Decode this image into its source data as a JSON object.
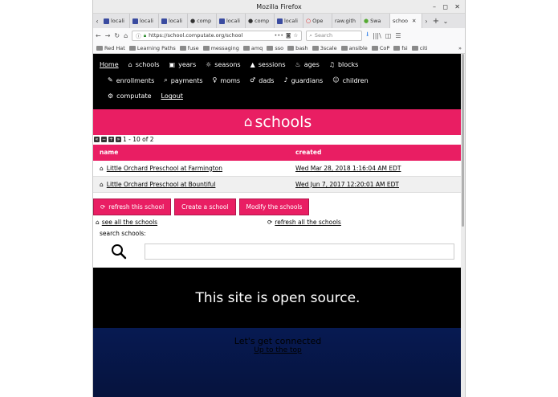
{
  "window": {
    "title": "Mozilla Firefox",
    "controls": [
      "–",
      "◻",
      "✕"
    ]
  },
  "tabs": [
    {
      "label": "locali",
      "icon": "site-icon"
    },
    {
      "label": "locali",
      "icon": "site-icon"
    },
    {
      "label": "locali",
      "icon": "site-icon"
    },
    {
      "label": "comp",
      "icon": "github-icon"
    },
    {
      "label": "locali",
      "icon": "site-icon"
    },
    {
      "label": "comp",
      "icon": "github-icon"
    },
    {
      "label": "locali",
      "icon": "site-icon"
    },
    {
      "label": "Ope",
      "icon": "openshift-icon"
    },
    {
      "label": "raw.gith",
      "icon": ""
    },
    {
      "label": "Swa",
      "icon": "swagger-icon"
    },
    {
      "label": "schoo",
      "icon": "",
      "active": true
    }
  ],
  "navbar": {
    "url": "https://school.computate.org/school",
    "search_placeholder": "Search"
  },
  "bookmarks": [
    "Red Hat",
    "Learning Paths",
    "fuse",
    "messaging",
    "amq",
    "sso",
    "bash",
    "3scale",
    "ansible",
    "CoP",
    "fsi",
    "citi"
  ],
  "topnav": {
    "row1": [
      {
        "label": "Home",
        "icon": "",
        "underline": true
      },
      {
        "label": "schools",
        "icon": "school-icon"
      },
      {
        "label": "years",
        "icon": "calendar-check-icon"
      },
      {
        "label": "seasons",
        "icon": "sun-icon"
      },
      {
        "label": "sessions",
        "icon": "graduation-cap-icon"
      },
      {
        "label": "ages",
        "icon": "birthday-cake-icon"
      },
      {
        "label": "blocks",
        "icon": "bell-icon"
      }
    ],
    "row2": [
      {
        "label": "enrollments",
        "icon": "edit-icon"
      },
      {
        "label": "payments",
        "icon": "search-dollar-icon"
      },
      {
        "label": "moms",
        "icon": "female-icon"
      },
      {
        "label": "dads",
        "icon": "male-icon"
      },
      {
        "label": "guardians",
        "icon": "guitar-icon"
      },
      {
        "label": "children",
        "icon": "child-icon"
      }
    ],
    "row3": [
      {
        "label": "computate",
        "icon": "user-cog-icon"
      },
      {
        "label": "Logout",
        "icon": "",
        "underline": true
      }
    ]
  },
  "banner": {
    "title": "schools"
  },
  "pager": {
    "text": "1 - 10 of 2"
  },
  "table": {
    "headers": [
      "name",
      "created"
    ],
    "rows": [
      {
        "name": "Little Orchard Preschool at Farmington",
        "created": "Wed Mar 28, 2018 1:16:04 AM EDT"
      },
      {
        "name": "Little Orchard Preschool at Bountiful",
        "created": "Wed Jun 7, 2017 12:20:01 AM EDT"
      }
    ]
  },
  "actions": {
    "refresh_this": "refresh this school",
    "create": "Create a school",
    "modify": "Modify the schools"
  },
  "links": {
    "see_all": "see all the schools",
    "refresh_all": "refresh all the schools"
  },
  "search": {
    "label": "search schools:",
    "value": ""
  },
  "footer": {
    "open_source": "This site is open source.",
    "connected": "Let's get connected",
    "up": "Up to the top"
  },
  "colors": {
    "accent": "#e91e63",
    "nav_bg": "#000000",
    "footer_blue": "#071a52"
  }
}
